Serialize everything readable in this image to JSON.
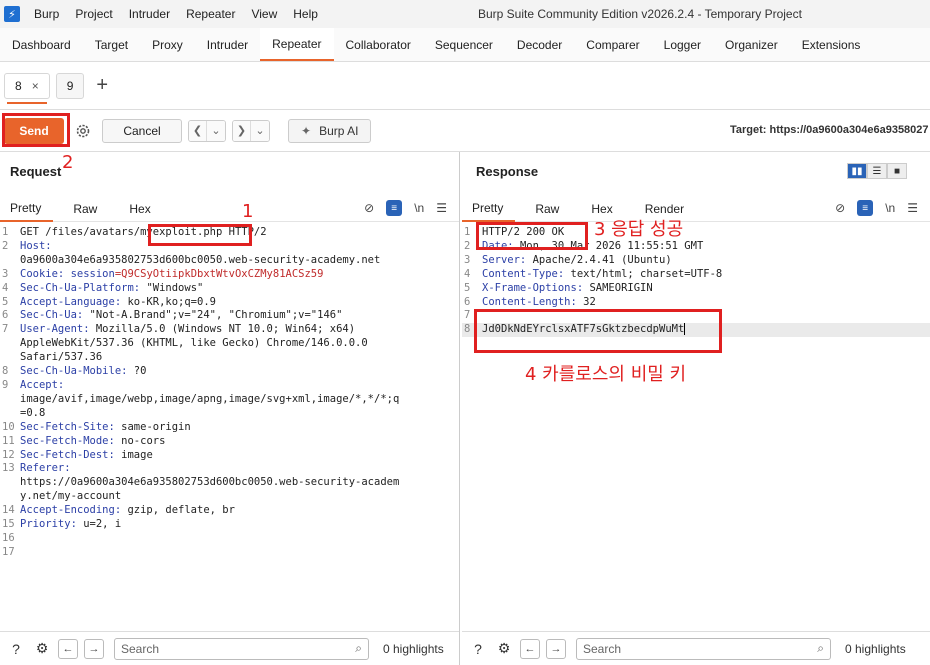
{
  "menubar": {
    "logo": "lightning-icon",
    "items": [
      "Burp",
      "Project",
      "Intruder",
      "Repeater",
      "View",
      "Help"
    ],
    "window_title": "Burp Suite Community Edition v2026.2.4 - Temporary Project"
  },
  "main_tabs": [
    "Dashboard",
    "Target",
    "Proxy",
    "Intruder",
    "Repeater",
    "Collaborator",
    "Sequencer",
    "Decoder",
    "Comparer",
    "Logger",
    "Organizer",
    "Extensions"
  ],
  "main_tab_active": "Repeater",
  "sub_tabs": [
    {
      "label": "8",
      "close": "×"
    },
    {
      "label": "9"
    }
  ],
  "toolbar": {
    "send": "Send",
    "cancel": "Cancel",
    "burp_ai": "Burp AI",
    "target": "Target: https://0a9600a304e6a9358027"
  },
  "request": {
    "title": "Request",
    "tabs": [
      "Pretty",
      "Raw",
      "Hex"
    ],
    "newline_toggle": "\\n",
    "lines": [
      {
        "n": "1",
        "parts": [
          {
            "t": "GET /files/avatars/",
            "c": ""
          },
          {
            "t": "myexploit.php",
            "c": ""
          },
          {
            "t": " HTTP/2",
            "c": ""
          }
        ]
      },
      {
        "n": "2",
        "parts": [
          {
            "t": "Host:",
            "c": "k"
          }
        ]
      },
      {
        "n": "",
        "parts": [
          {
            "t": "0a9600a304e6a935802753d600bc0050.web-security-academy.net",
            "c": ""
          }
        ]
      },
      {
        "n": "3",
        "parts": [
          {
            "t": "Cookie: ",
            "c": "k"
          },
          {
            "t": "session",
            "c": "k"
          },
          {
            "t": "=Q9CSyOtiipkDbxtWtvOxCZMy81ACSz59",
            "c": "cookie"
          }
        ]
      },
      {
        "n": "4",
        "parts": [
          {
            "t": "Sec-Ch-Ua-Platform: ",
            "c": "k"
          },
          {
            "t": "\"Windows\"",
            "c": ""
          }
        ]
      },
      {
        "n": "5",
        "parts": [
          {
            "t": "Accept-Language: ",
            "c": "k"
          },
          {
            "t": "ko-KR,ko;q=0.9",
            "c": ""
          }
        ]
      },
      {
        "n": "6",
        "parts": [
          {
            "t": "Sec-Ch-Ua: ",
            "c": "k"
          },
          {
            "t": "\"Not-A.Brand\";v=\"24\", \"Chromium\";v=\"146\"",
            "c": ""
          }
        ]
      },
      {
        "n": "7",
        "parts": [
          {
            "t": "User-Agent: ",
            "c": "k"
          },
          {
            "t": "Mozilla/5.0 (Windows NT 10.0; Win64; x64)",
            "c": ""
          }
        ]
      },
      {
        "n": "",
        "parts": [
          {
            "t": "AppleWebKit/537.36 (KHTML, like Gecko) Chrome/146.0.0.0",
            "c": ""
          }
        ]
      },
      {
        "n": "",
        "parts": [
          {
            "t": "Safari/537.36",
            "c": ""
          }
        ]
      },
      {
        "n": "8",
        "parts": [
          {
            "t": "Sec-Ch-Ua-Mobile: ",
            "c": "k"
          },
          {
            "t": "?0",
            "c": ""
          }
        ]
      },
      {
        "n": "9",
        "parts": [
          {
            "t": "Accept:",
            "c": "k"
          }
        ]
      },
      {
        "n": "",
        "parts": [
          {
            "t": "image/avif,image/webp,image/apng,image/svg+xml,image/*,*/*;q",
            "c": ""
          }
        ]
      },
      {
        "n": "",
        "parts": [
          {
            "t": "=0.8",
            "c": ""
          }
        ]
      },
      {
        "n": "10",
        "parts": [
          {
            "t": "Sec-Fetch-Site: ",
            "c": "k"
          },
          {
            "t": "same-origin",
            "c": ""
          }
        ]
      },
      {
        "n": "11",
        "parts": [
          {
            "t": "Sec-Fetch-Mode: ",
            "c": "k"
          },
          {
            "t": "no-cors",
            "c": ""
          }
        ]
      },
      {
        "n": "12",
        "parts": [
          {
            "t": "Sec-Fetch-Dest: ",
            "c": "k"
          },
          {
            "t": "image",
            "c": ""
          }
        ]
      },
      {
        "n": "13",
        "parts": [
          {
            "t": "Referer:",
            "c": "k"
          }
        ]
      },
      {
        "n": "",
        "parts": [
          {
            "t": "https://0a9600a304e6a935802753d600bc0050.web-security-academ",
            "c": ""
          }
        ]
      },
      {
        "n": "",
        "parts": [
          {
            "t": "y.net/my-account",
            "c": ""
          }
        ]
      },
      {
        "n": "14",
        "parts": [
          {
            "t": "Accept-Encoding: ",
            "c": "k"
          },
          {
            "t": "gzip, deflate, br",
            "c": ""
          }
        ]
      },
      {
        "n": "15",
        "parts": [
          {
            "t": "Priority: ",
            "c": "k"
          },
          {
            "t": "u=2, i",
            "c": ""
          }
        ]
      },
      {
        "n": "16",
        "parts": [
          {
            "t": "",
            "c": ""
          }
        ]
      },
      {
        "n": "17",
        "parts": [
          {
            "t": "",
            "c": ""
          }
        ]
      }
    ],
    "search_placeholder": "Search",
    "highlights": "0 highlights"
  },
  "response": {
    "title": "Response",
    "tabs": [
      "Pretty",
      "Raw",
      "Hex",
      "Render"
    ],
    "newline_toggle": "\\n",
    "lines": [
      {
        "n": "1",
        "parts": [
          {
            "t": "HTTP/2 200 OK",
            "c": ""
          }
        ]
      },
      {
        "n": "2",
        "parts": [
          {
            "t": "Date: ",
            "c": "k"
          },
          {
            "t": "Mon, 30 Mar 2026 11:55:51 GMT",
            "c": ""
          }
        ]
      },
      {
        "n": "3",
        "parts": [
          {
            "t": "Server: ",
            "c": "k"
          },
          {
            "t": "Apache/2.4.41 (Ubuntu)",
            "c": ""
          }
        ]
      },
      {
        "n": "4",
        "parts": [
          {
            "t": "Content-Type: ",
            "c": "k"
          },
          {
            "t": "text/html; charset=UTF-8",
            "c": ""
          }
        ]
      },
      {
        "n": "5",
        "parts": [
          {
            "t": "X-Frame-Options: ",
            "c": "k"
          },
          {
            "t": "SAMEORIGIN",
            "c": ""
          }
        ]
      },
      {
        "n": "6",
        "parts": [
          {
            "t": "Content-Length: ",
            "c": "k"
          },
          {
            "t": "32",
            "c": ""
          }
        ]
      },
      {
        "n": "7",
        "parts": [
          {
            "t": "",
            "c": ""
          }
        ]
      },
      {
        "n": "8",
        "parts": [
          {
            "t": "Jd0DkNdEYrclsxATF7sGktzbecdpWuMt",
            "c": ""
          }
        ],
        "selected": true
      }
    ],
    "search_placeholder": "Search",
    "highlights": "0 highlights"
  },
  "annotations": [
    {
      "label": "1"
    },
    {
      "label": "2"
    },
    {
      "label": "3 응답 성공"
    },
    {
      "label": "4 카를로스의 비밀 키"
    }
  ],
  "colors": {
    "accent": "#e8642b",
    "annotation": "#e02020",
    "keyword": "#2b3fa6",
    "cookie": "#c02b2b"
  }
}
